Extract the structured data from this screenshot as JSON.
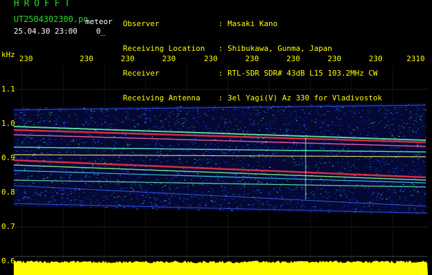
{
  "header": {
    "logo": "HROFFT",
    "filename": "UT2504302300.pn",
    "datetime": "25.04.30 23:00",
    "mode": "meteor",
    "count": "0_"
  },
  "station": {
    "labels": [
      "Observer",
      "Receiving Location",
      "Receiver",
      "Receiving Antenna"
    ],
    "values": [
      ": Masaki Kano",
      ": Shibukawa, Gunma, Japan",
      ": RTL-SDR SDR# 43dB L15 103.2MHz CW",
      ": 3el Yagi(V) Az 330 for Vladivostok"
    ]
  },
  "axis": {
    "unit": "kHz",
    "time_ticks": [
      "230",
      "230",
      "230",
      "230",
      "230",
      "230",
      "230",
      "230",
      "230",
      "2310"
    ],
    "freq_ticks": [
      "1.1",
      "1.0",
      "0.9",
      "0.8",
      "0.7",
      "0.6"
    ]
  },
  "colors": {
    "background": "#000000",
    "label_green": "#22dd22",
    "text_white": "#ffffff",
    "axis_yellow": "#ffff00",
    "signal_red": "#ff3344",
    "noise_blue": "#1a3aff",
    "noise_cyan": "#22dddd"
  }
}
